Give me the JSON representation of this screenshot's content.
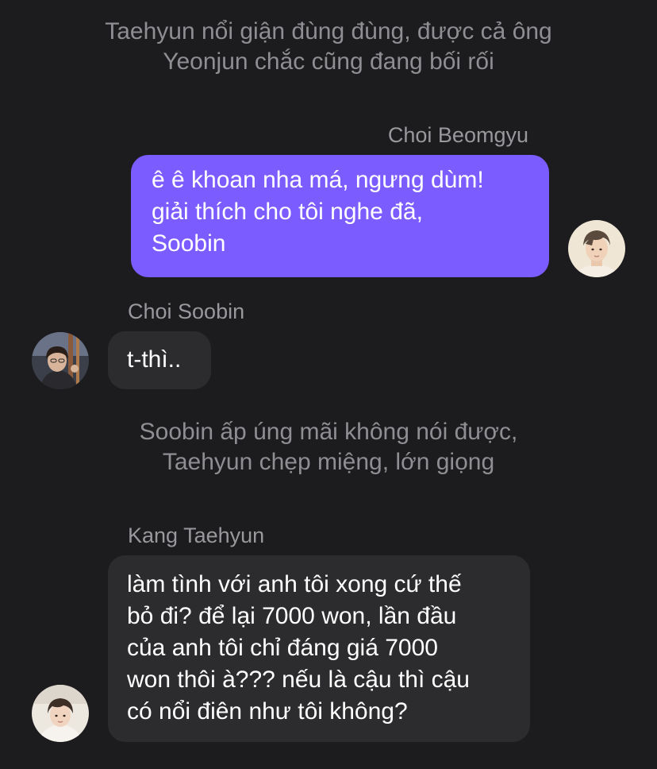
{
  "colors": {
    "background": "#1c1c1e",
    "outgoing_bubble": "#7b5cff",
    "incoming_bubble": "#2c2c2e",
    "narration_text": "#8e8e93",
    "sender_text": "#98989d",
    "message_text": "#ffffff"
  },
  "chat": {
    "narration_1": {
      "lines": [
        "Taehyun nổi giận đùng đùng, được cả ông",
        "Yeonjun chắc cũng đang bối rối"
      ]
    },
    "message_1": {
      "sender": "Choi Beomgyu",
      "direction": "outgoing",
      "lines": [
        "ê ê khoan nha má, ngưng dùm!",
        "giải thích cho tôi nghe đã,",
        "Soobin"
      ],
      "avatar_icon": "user-avatar-photo"
    },
    "message_2": {
      "sender": "Choi Soobin",
      "direction": "incoming",
      "lines": [
        "t-thì.."
      ],
      "avatar_icon": "user-avatar-photo"
    },
    "narration_2": {
      "lines": [
        "Soobin ấp úng mãi không nói được,",
        "Taehyun chẹp miệng, lớn giọng"
      ]
    },
    "message_3": {
      "sender": "Kang Taehyun",
      "direction": "incoming",
      "lines": [
        "làm tình với anh tôi xong cứ thế",
        "bỏ đi? để lại 7000 won, lần đầu",
        "của anh tôi chỉ đáng giá 7000",
        "won thôi à??? nếu là cậu thì cậu",
        "có nổi điên như tôi không?"
      ],
      "avatar_icon": "user-avatar-photo"
    }
  }
}
